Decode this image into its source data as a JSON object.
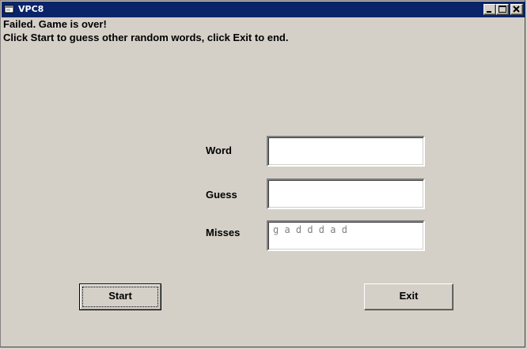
{
  "window": {
    "title": "VPC8",
    "controls": {
      "minimize": "minimize",
      "maximize": "maximize",
      "close": "close"
    }
  },
  "status": {
    "line1": "Failed. Game is over!",
    "line2": "Click Start to guess other random words, click Exit to end."
  },
  "form": {
    "word_label": "Word",
    "word_value": "",
    "guess_label": "Guess",
    "guess_value": "",
    "misses_label": "Misses",
    "misses_value": "g a d d d a d"
  },
  "buttons": {
    "start_label": "Start",
    "exit_label": "Exit"
  },
  "colors": {
    "titlebar": "#0a246a",
    "face": "#d4d0c8"
  }
}
